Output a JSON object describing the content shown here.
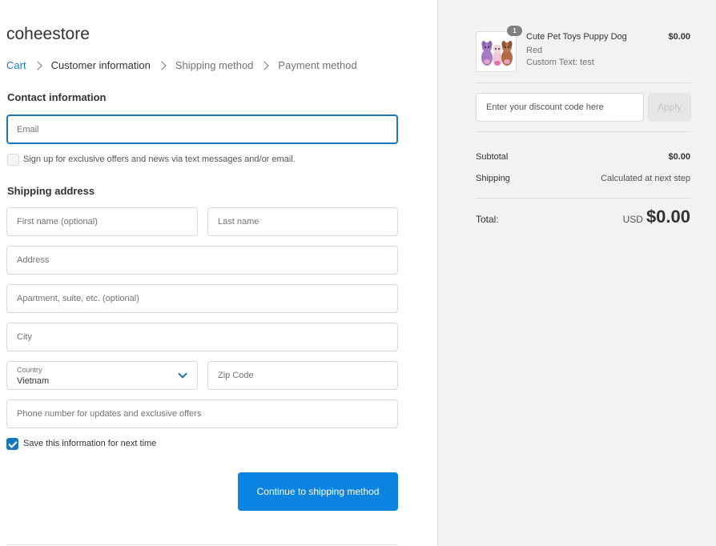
{
  "store": {
    "name": "coheestore"
  },
  "breadcrumb": {
    "cart": "Cart",
    "customer_information": "Customer information",
    "shipping_method": "Shipping method",
    "payment_method": "Payment method"
  },
  "contact": {
    "title": "Contact information",
    "email_placeholder": "Email",
    "email_value": "",
    "marketing_label": "Sign up for exclusive offers and news via text messages and/or email.",
    "marketing_checked": false
  },
  "shipping": {
    "title": "Shipping address",
    "first_name_placeholder": "First name (optional)",
    "last_name_placeholder": "Last name",
    "address_placeholder": "Address",
    "apartment_placeholder": "Apartment, suite, etc. (optional)",
    "city_placeholder": "City",
    "country_label": "Country",
    "country_value": "Vietnam",
    "zip_placeholder": "Zip Code",
    "phone_placeholder": "Phone number for updates and exclusive offers",
    "save_label": "Save this information for next time",
    "save_checked": true
  },
  "actions": {
    "continue_label": "Continue to shipping method"
  },
  "summary": {
    "product": {
      "quantity": "1",
      "name": "Cute Pet Toys Puppy Dog",
      "variant": "Red",
      "custom_text": "Custom Text: test",
      "price": "$0.00",
      "image_icon": "dog-toys-image"
    },
    "discount": {
      "placeholder": "Enter your discount code here",
      "apply_label": "Apply"
    },
    "subtotal_label": "Subtotal",
    "subtotal_value": "$0.00",
    "shipping_label": "Shipping",
    "shipping_value": "Calculated at next step",
    "total_label": "Total:",
    "total_currency": "USD",
    "total_amount": "$0.00"
  },
  "colors": {
    "accent": "#0a84e0",
    "link": "#1a7ac4",
    "focus": "#1877b8",
    "sidebar_bg": "#f2f2f2"
  }
}
